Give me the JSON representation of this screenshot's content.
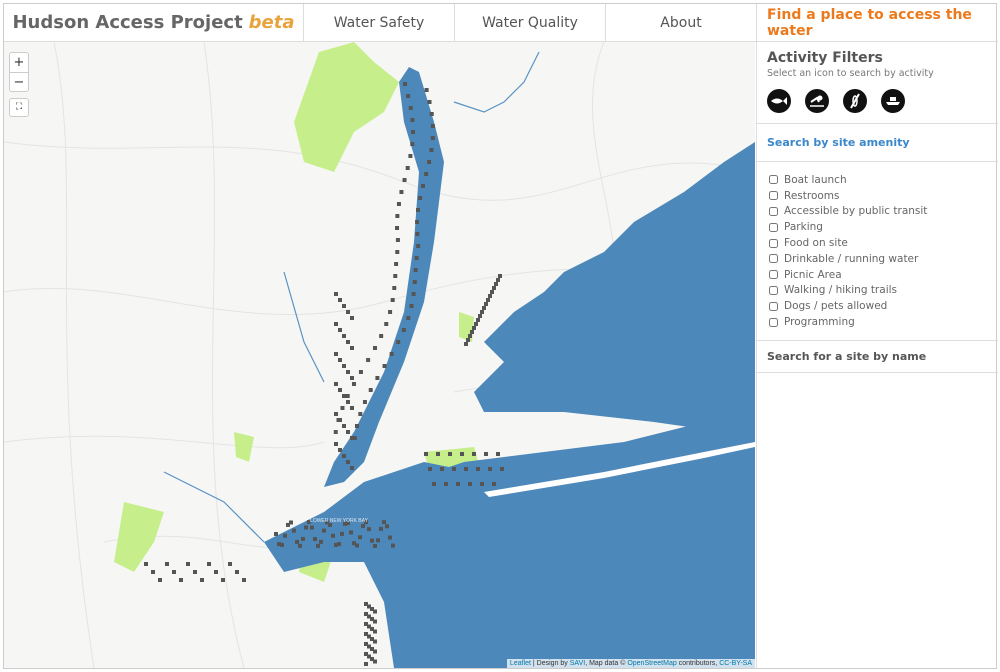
{
  "header": {
    "title": "Hudson Access Project",
    "title_suffix": "beta",
    "nav": [
      "Water Safety",
      "Water Quality",
      "About"
    ]
  },
  "map": {
    "zoom_in": "+",
    "zoom_out": "−",
    "fullscreen": "⛶",
    "label_bay": "LOWER NEW YORK BAY",
    "attribution": {
      "leaflet": "Leaflet",
      "design_prefix": "| Design by",
      "savi": "SAVI",
      "mapdata": ", Map data ©",
      "osm": "OpenStreetMap",
      "contrib": "contributors,",
      "license": "CC-BY-SA"
    },
    "colors": {
      "water": "#4d88ba",
      "park": "#c6ef8c",
      "site": "#555555",
      "land": "#f6f6f4"
    }
  },
  "sidebar": {
    "title": "Find a place to access the water",
    "activity_title": "Activity Filters",
    "activity_sub": "Select an icon to search by activity",
    "activities": [
      "fishing-icon",
      "swimming-icon",
      "kayaking-icon",
      "boating-icon"
    ],
    "amenity_title": "Search by site amenity",
    "amenities": [
      "Boat launch",
      "Restrooms",
      "Accessible by public transit",
      "Parking",
      "Food on site",
      "Drinkable / running water",
      "Picnic Area",
      "Walking / hiking trails",
      "Dogs / pets allowed",
      "Programming"
    ],
    "name_search": "Search for a site by name"
  }
}
